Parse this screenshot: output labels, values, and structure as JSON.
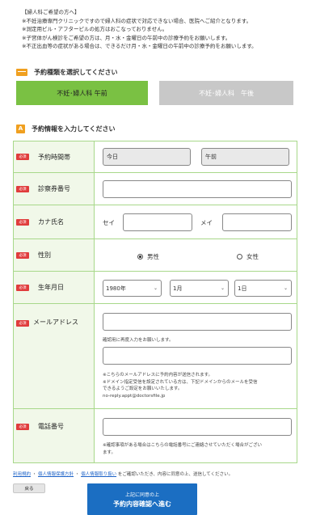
{
  "notice": {
    "heading": "【婦人科ご希望の方へ】",
    "lines": [
      "※不妊治療専門クリニックですので婦人科の症状で対応できない場合、医院へご紹介となります。",
      "※測定用ピル・アフターピルの処方はおこなっておりません。",
      "※子宮体がん検診をご希望の方は、月・水・金曜日の午前中の診療予約をお願いします。",
      "※不正出血等の症状がある場合は、できるだけ月・水・金曜日の午前中の診療予約をお願いします。"
    ]
  },
  "section_type": {
    "title": "予約種類を選択してください"
  },
  "type_buttons": [
    {
      "label": "不妊･婦人科 午前",
      "selected": true
    },
    {
      "label": "不妊･婦人科　午後",
      "selected": false
    }
  ],
  "section_info": {
    "icon": "A",
    "title": "予約情報を入力してください"
  },
  "required_badge": "必須",
  "form": {
    "time": {
      "label": "予約時間帯",
      "date_value": "今日",
      "slot_value": "午前"
    },
    "card": {
      "label": "診察券番号",
      "value": ""
    },
    "kana": {
      "label": "カナ氏名",
      "sei_label": "セイ",
      "mei_label": "メイ",
      "sei_value": "",
      "mei_value": ""
    },
    "gender": {
      "label": "性別",
      "male": "男性",
      "female": "女性",
      "selected": "male"
    },
    "birth": {
      "label": "生年月日",
      "year": "1980年",
      "month": "1月",
      "day": "1日"
    },
    "email": {
      "label": "メールアドレス",
      "value": "",
      "confirm_note": "確認用に再度入力をお願いします。",
      "confirm_value": "",
      "notes": [
        "※こちらのメールアドレスに予約内容が送信されます。",
        "※ドメイン指定受信を設定されている方は、下記ドメインからのメールを受信",
        "できるようご設定をお願いいたします。",
        "no-reply.appt@doctorsfile.jp"
      ]
    },
    "phone": {
      "label": "電話番号",
      "value": "",
      "notes": [
        "※確認事項がある場合はこちらの電話番号にご連絡させていただく場合がござい",
        "ます。"
      ]
    }
  },
  "consent": {
    "terms": "利用規約",
    "sep": "・",
    "privacy_policy": "個人情報保護方針",
    "privacy_handling": "個人情報取り扱い",
    "tail": "をご確認いただき、内容に同意の上、送信してください。"
  },
  "buttons": {
    "back": "戻る",
    "submit_line1": "上記に同意の上",
    "submit_line2": "予約内容確認へ進む"
  },
  "colors": {
    "accent_green": "#7ac143",
    "inactive_gray": "#c8c8c8",
    "required_red": "#e03c3c",
    "section_orange": "#f0a020",
    "submit_blue": "#1b6ec2"
  }
}
